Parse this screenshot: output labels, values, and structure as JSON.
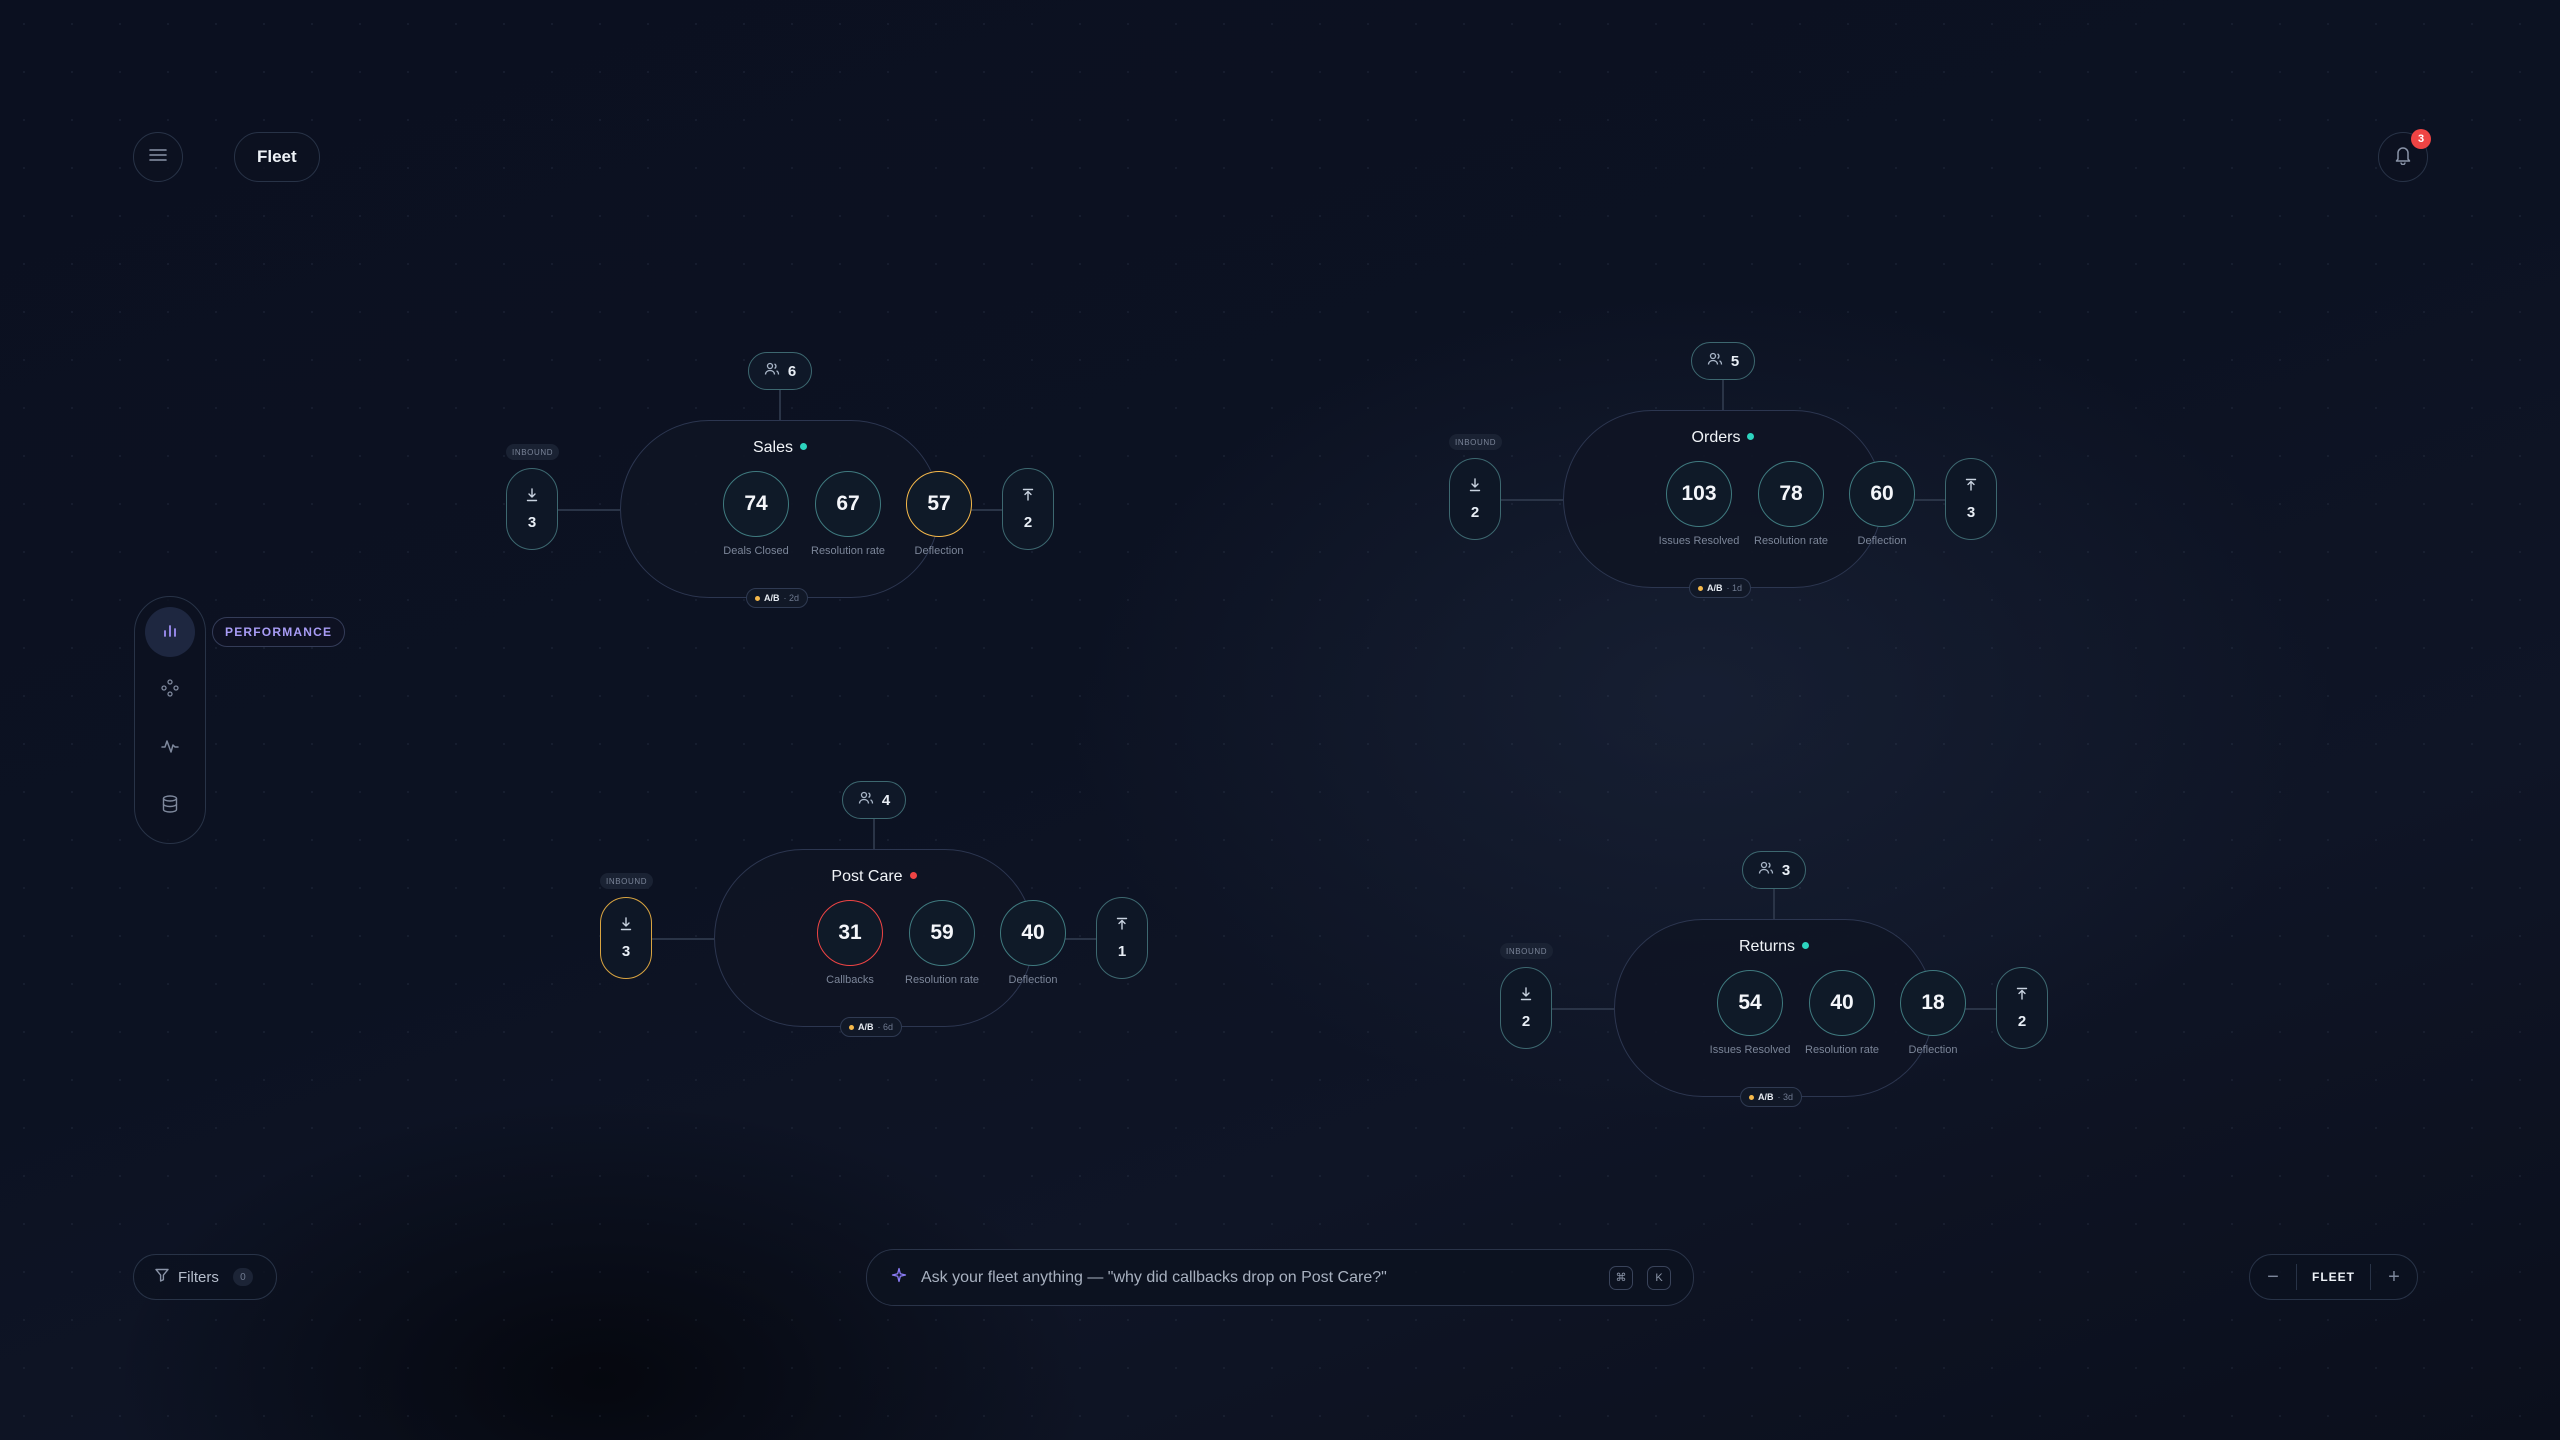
{
  "header": {
    "menu_icon": "hamburger-icon",
    "title": "Fleet",
    "notifications": {
      "icon": "bell-icon",
      "count": "3"
    }
  },
  "sidebar": {
    "items": [
      {
        "icon": "bar-chart-icon",
        "label": "PERFORMANCE",
        "active": true
      },
      {
        "icon": "nodes-icon"
      },
      {
        "icon": "activity-icon"
      },
      {
        "icon": "database-icon"
      }
    ]
  },
  "colors": {
    "ok": "#2dd4bf",
    "critical": "#ef4444",
    "warning": "#f5b84a",
    "ring_default": "#3f7a7f"
  },
  "clusters": [
    {
      "name": "Sales",
      "status": "ok",
      "team_count": "6",
      "metrics": [
        {
          "value": "74",
          "label": "Deals Closed",
          "state": "normal"
        },
        {
          "value": "67",
          "label": "Resolution rate",
          "state": "normal"
        },
        {
          "value": "57",
          "label": "Deflection",
          "state": "warning"
        }
      ],
      "inbound": {
        "tag": "INBOUND",
        "value": "3",
        "state": "normal"
      },
      "outbound": {
        "value": "2"
      },
      "ab": {
        "label": "A/B",
        "age": "· 2d"
      }
    },
    {
      "name": "Orders",
      "status": "ok",
      "team_count": "5",
      "metrics": [
        {
          "value": "103",
          "label": "Issues Resolved",
          "state": "normal"
        },
        {
          "value": "78",
          "label": "Resolution rate",
          "state": "normal"
        },
        {
          "value": "60",
          "label": "Deflection",
          "state": "normal"
        }
      ],
      "inbound": {
        "tag": "INBOUND",
        "value": "2",
        "state": "normal"
      },
      "outbound": {
        "value": "3"
      },
      "ab": {
        "label": "A/B",
        "age": "· 1d"
      }
    },
    {
      "name": "Post Care",
      "status": "critical",
      "team_count": "4",
      "metrics": [
        {
          "value": "31",
          "label": "Callbacks",
          "state": "critical"
        },
        {
          "value": "59",
          "label": "Resolution rate",
          "state": "normal"
        },
        {
          "value": "40",
          "label": "Deflection",
          "state": "normal"
        }
      ],
      "inbound": {
        "tag": "INBOUND",
        "value": "3",
        "state": "warning"
      },
      "outbound": {
        "value": "1"
      },
      "ab": {
        "label": "A/B",
        "age": "· 6d"
      }
    },
    {
      "name": "Returns",
      "status": "ok",
      "team_count": "3",
      "metrics": [
        {
          "value": "54",
          "label": "Issues Resolved",
          "state": "normal"
        },
        {
          "value": "40",
          "label": "Resolution rate",
          "state": "normal"
        },
        {
          "value": "18",
          "label": "Deflection",
          "state": "normal"
        }
      ],
      "inbound": {
        "tag": "INBOUND",
        "value": "2",
        "state": "normal"
      },
      "outbound": {
        "value": "2"
      },
      "ab": {
        "label": "A/B",
        "age": "· 3d"
      }
    }
  ],
  "footer": {
    "filters": {
      "label": "Filters",
      "count": "0"
    },
    "ask": {
      "placeholder": "Ask your fleet anything — \"why did callbacks drop on Post Care?\"",
      "shortcut": [
        "⌘",
        "K"
      ]
    },
    "zoom": {
      "minus": "−",
      "label": "FLEET",
      "plus": "+"
    }
  }
}
